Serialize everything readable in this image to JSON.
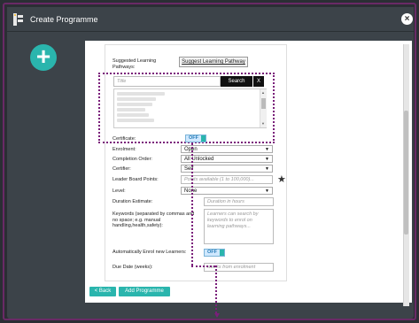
{
  "window": {
    "title": "Create Programme"
  },
  "form": {
    "suggested_label": "Suggested Learning Pathways:",
    "suggested_button": "Suggest Learning Pathway",
    "search_placeholder": "Title",
    "search_button": "Search",
    "clear_button": "X",
    "certificate_label": "Certificate:",
    "certificate_toggle": "OFF",
    "enrolment_label": "Enrolment:",
    "enrolment_value": "Open",
    "completion_label": "Completion Order:",
    "completion_value": "All Unlocked",
    "certifier_label": "Certifier:",
    "certifier_value": "Self",
    "points_label": "Leader Board Points:",
    "points_placeholder": "Points available (1 to 100,000)...",
    "level_label": "Level:",
    "level_value": "None",
    "duration_label": "Duration Estimate:",
    "duration_placeholder": "Duration in hours",
    "keywords_label": "Keywords (separated by commas and no space; e.g. manual handling,health,safety):",
    "keywords_placeholder": "Learners can search by keywords to enrol on learning pathways...",
    "auto_enrol_label": "Automatically Enrol new Learners:",
    "auto_enrol_toggle": "OFF",
    "due_label": "Due Date (weeks):",
    "due_placeholder": "weeks from enrolment"
  },
  "buttons": {
    "back": "< Back",
    "add": "Add Programme"
  }
}
